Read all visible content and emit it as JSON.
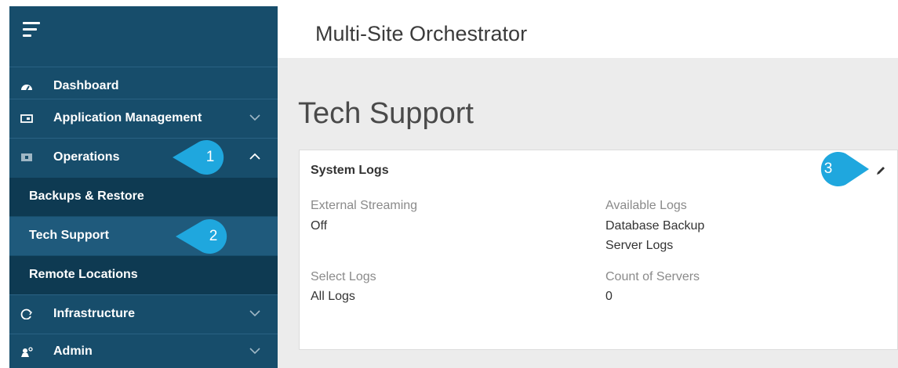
{
  "header": {
    "app_title": "Multi-Site Orchestrator"
  },
  "sidebar": {
    "items": [
      {
        "label": "Dashboard",
        "icon": "dashboard-icon"
      },
      {
        "label": "Application Management",
        "icon": "application-icon",
        "chevron": "chevron-down-icon"
      },
      {
        "label": "Operations",
        "icon": "operations-icon",
        "chevron": "chevron-up-icon"
      },
      {
        "label": "Infrastructure",
        "icon": "infrastructure-icon",
        "chevron": "chevron-down-icon"
      },
      {
        "label": "Admin",
        "icon": "admin-icon",
        "chevron": "chevron-down-icon"
      }
    ],
    "sub_items": [
      {
        "label": "Backups & Restore"
      },
      {
        "label": "Tech Support",
        "active": true
      },
      {
        "label": "Remote Locations"
      }
    ]
  },
  "main": {
    "page_title": "Tech Support",
    "card": {
      "title": "System Logs",
      "fields": [
        {
          "label": "External Streaming",
          "values": [
            "Off"
          ]
        },
        {
          "label": "Available Logs",
          "values": [
            "Database Backup",
            "Server Logs"
          ]
        },
        {
          "label": "Select Logs",
          "values": [
            "All Logs"
          ]
        },
        {
          "label": "Count of Servers",
          "values": [
            "0"
          ]
        }
      ]
    }
  },
  "callouts": [
    "1",
    "2",
    "3"
  ],
  "colors": {
    "sidebar": "#174d6b",
    "submenu": "#0e3a52",
    "submenu_active": "#1f5a7c",
    "callout": "#1fa7de",
    "main_bg": "#ececec"
  }
}
